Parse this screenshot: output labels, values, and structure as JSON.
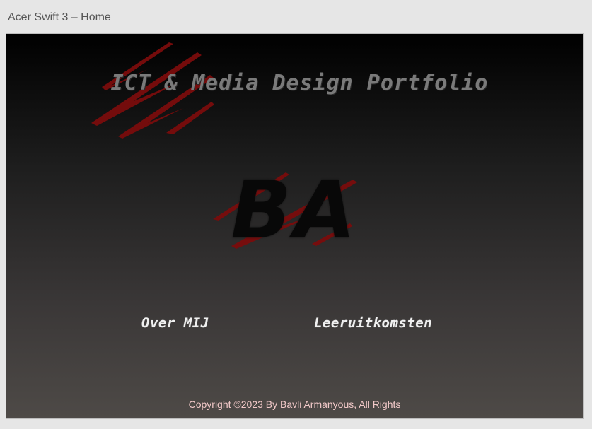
{
  "window": {
    "title": "Acer Swift 3 – Home"
  },
  "header": {
    "title": "ICT & Media Design Portfolio"
  },
  "hero": {
    "monogram": "BA"
  },
  "nav": {
    "items": [
      {
        "label": "Over MIJ"
      },
      {
        "label": "Leeruitkomsten"
      }
    ]
  },
  "footer": {
    "copyright": "Copyright ©2023 By Bavli Armanyous, All Rights"
  },
  "colors": {
    "accent": "#7a0c0c",
    "background_top": "#000000",
    "background_bottom": "#4e4a47",
    "footer_text": "#f2c9c9"
  },
  "icons": [
    "claw-scratch-icon",
    "claw-scratch-icon"
  ]
}
